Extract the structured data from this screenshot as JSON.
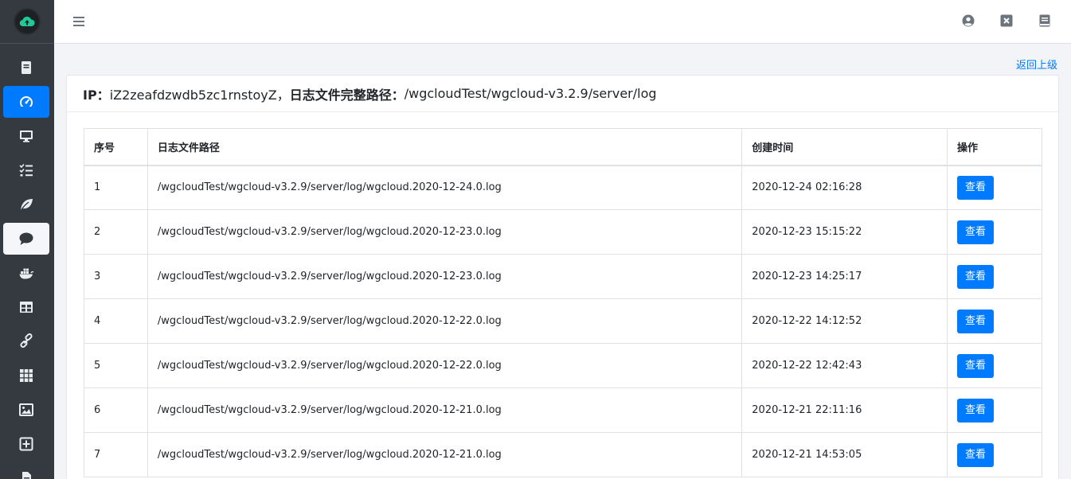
{
  "header": {
    "ip_label": "IP：",
    "ip_value": "iZ2zeafdzwdb5zc1rnstoyZ，",
    "path_label": "日志文件完整路径：",
    "path_value": "/wgcloudTest/wgcloud-v3.2.9/server/log"
  },
  "back_link": "返回上级",
  "table": {
    "columns": [
      "序号",
      "日志文件路径",
      "创建时间",
      "操作"
    ],
    "rows": [
      {
        "idx": "1",
        "path": "/wgcloudTest/wgcloud-v3.2.9/server/log/wgcloud.2020-12-24.0.log",
        "time": "2020-12-24 02:16:28",
        "action": "查看"
      },
      {
        "idx": "2",
        "path": "/wgcloudTest/wgcloud-v3.2.9/server/log/wgcloud.2020-12-23.0.log",
        "time": "2020-12-23 15:15:22",
        "action": "查看"
      },
      {
        "idx": "3",
        "path": "/wgcloudTest/wgcloud-v3.2.9/server/log/wgcloud.2020-12-23.0.log",
        "time": "2020-12-23 14:25:17",
        "action": "查看"
      },
      {
        "idx": "4",
        "path": "/wgcloudTest/wgcloud-v3.2.9/server/log/wgcloud.2020-12-22.0.log",
        "time": "2020-12-22 14:12:52",
        "action": "查看"
      },
      {
        "idx": "5",
        "path": "/wgcloudTest/wgcloud-v3.2.9/server/log/wgcloud.2020-12-22.0.log",
        "time": "2020-12-22 12:42:43",
        "action": "查看"
      },
      {
        "idx": "6",
        "path": "/wgcloudTest/wgcloud-v3.2.9/server/log/wgcloud.2020-12-21.0.log",
        "time": "2020-12-21 22:11:16",
        "action": "查看"
      },
      {
        "idx": "7",
        "path": "/wgcloudTest/wgcloud-v3.2.9/server/log/wgcloud.2020-12-21.0.log",
        "time": "2020-12-21 14:53:05",
        "action": "查看"
      }
    ]
  },
  "sidebar": {
    "icons": [
      "book-icon",
      "dashboard-icon",
      "monitor-icon",
      "tasks-icon",
      "leaf-icon",
      "comment-icon",
      "docker-icon",
      "table-icon",
      "link-icon",
      "grid-icon",
      "image-icon",
      "plus-square-icon",
      "file-icon"
    ]
  },
  "topbar": {
    "icons": [
      "user-icon",
      "close-icon",
      "book-icon"
    ]
  },
  "colors": {
    "accent": "#007bff",
    "sidebar": "#343a40",
    "logo_green": "#20c997"
  }
}
